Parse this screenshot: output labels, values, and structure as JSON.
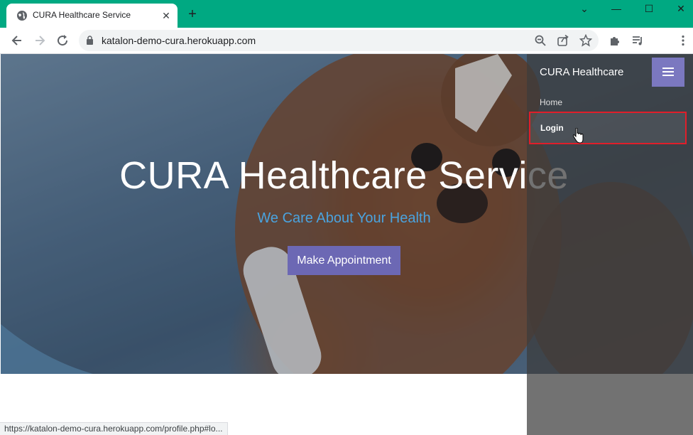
{
  "browser": {
    "tab_title": "CURA Healthcare Service",
    "tab_close": "✕",
    "new_tab": "+",
    "url": "katalon-demo-cura.herokuapp.com",
    "status_url": "https://katalon-demo-cura.herokuapp.com/profile.php#lo...",
    "window_controls": {
      "chevron": "⌄",
      "minimize": "—",
      "maximize": "☐",
      "close": "✕"
    }
  },
  "hero": {
    "title": "CURA Healthcare Service",
    "subtitle": "We Care About Your Health",
    "button_label": "Make Appointment"
  },
  "sidebar": {
    "brand": "CURA Healthcare",
    "items": [
      {
        "label": "Home"
      },
      {
        "label": "Login"
      }
    ]
  },
  "colors": {
    "titlebar": "#00a982",
    "accent": "#6c68b4",
    "subtitle": "#4aa3df",
    "highlight_border": "#e01e2a"
  },
  "icons": [
    "globe-icon",
    "close-icon",
    "plus-icon",
    "back-icon",
    "forward-icon",
    "reload-icon",
    "lock-icon",
    "zoom-icon",
    "share-icon",
    "star-icon",
    "extensions-icon",
    "media-icon",
    "kebab-menu-icon",
    "hamburger-icon",
    "pointer-cursor-icon"
  ]
}
